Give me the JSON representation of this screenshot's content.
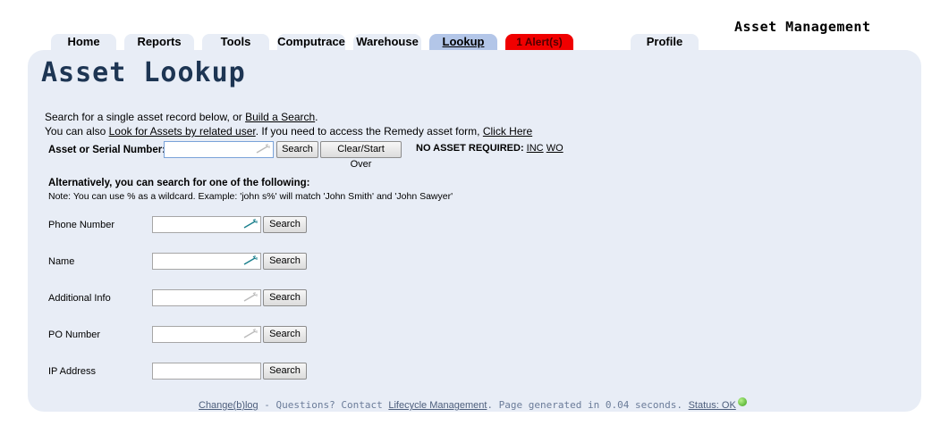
{
  "app_title": "Asset Management",
  "tabs": [
    {
      "label": "Home"
    },
    {
      "label": "Reports"
    },
    {
      "label": "Tools"
    },
    {
      "label": "Computrace"
    },
    {
      "label": "Warehouse"
    },
    {
      "label": "Lookup"
    },
    {
      "label": "1 Alert(s)"
    },
    {
      "label": "Profile"
    }
  ],
  "page_title": "Asset Lookup",
  "intro": {
    "line1_text": "Search for a single asset record below, or ",
    "line1_link": "Build a Search",
    "line1_end": ".",
    "line2_text": "You can also ",
    "line2_link": "Look for Assets by related user",
    "line2_mid": ". If you need to access the Remedy asset form, ",
    "line2_link2": "Click Here"
  },
  "asset_search": {
    "label": "Asset or Serial Number:",
    "value": "",
    "search_button": "Search",
    "clear_button": "Clear/Start Over",
    "no_asset_label": "NO ASSET REQUIRED:",
    "inc_link": "INC",
    "wo_link": "WO"
  },
  "alternative": {
    "heading": "Alternatively, you can search for one of the following:",
    "note": "Note: You can use % as a wildcard. Example: 'john s%' will match 'John Smith' and 'John Sawyer'"
  },
  "fields": [
    {
      "label": "Phone Number",
      "value": "",
      "button": "Search"
    },
    {
      "label": "Name",
      "value": "",
      "button": "Search"
    },
    {
      "label": "Additional Info",
      "value": "",
      "button": "Search"
    },
    {
      "label": "PO Number",
      "value": "",
      "button": "Search"
    },
    {
      "label": "IP Address",
      "value": "",
      "button": "Search"
    }
  ],
  "footer": {
    "changelog_link": "Change(b)log",
    "questions_text": " - Questions? Contact ",
    "lifecycle_link": "Lifecycle Management",
    "generated_text": ". Page generated in 0.04 seconds. ",
    "status_link": "Status: OK"
  },
  "colors": {
    "panel_bg": "#e8edf6",
    "active_tab": "#b3c6e8",
    "alert_tab": "#f00000",
    "title": "#1d3553",
    "status_ok": "#3ca01b"
  },
  "icons": {
    "wand": "magic-wand-icon",
    "status": "status-ok-icon"
  }
}
